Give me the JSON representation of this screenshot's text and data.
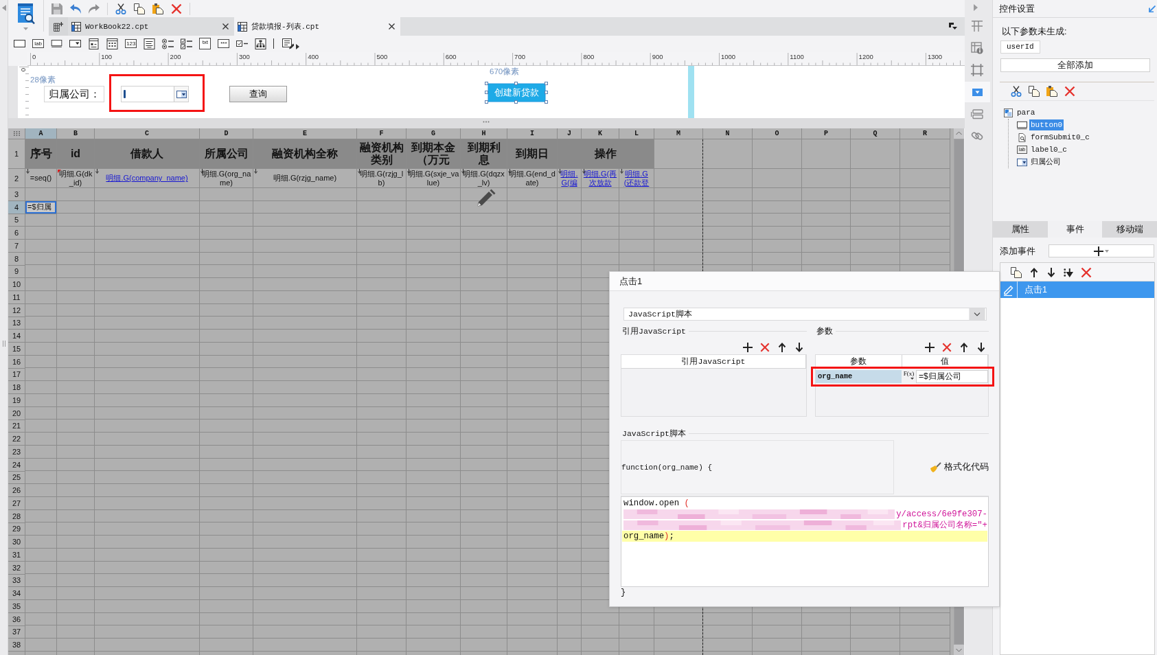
{
  "tabs": [
    {
      "label": "WorkBook22.cpt",
      "selected": false
    },
    {
      "label": "贷款填报-列表.cpt",
      "selected": true
    }
  ],
  "widget_palette": [
    {
      "kind": "text-field"
    },
    {
      "kind": "label",
      "text": "lab"
    },
    {
      "kind": "button"
    },
    {
      "kind": "combo"
    },
    {
      "kind": "form"
    },
    {
      "kind": "date"
    },
    {
      "kind": "number",
      "text": "123"
    },
    {
      "kind": "text-area"
    },
    {
      "kind": "radio-group"
    },
    {
      "kind": "checkbox-group"
    },
    {
      "kind": "file",
      "text": "txt"
    },
    {
      "kind": "password",
      "text": "***"
    },
    {
      "kind": "checkbox"
    },
    {
      "kind": "tree"
    },
    {
      "kind": "more"
    }
  ],
  "ruler": {
    "ticks": [
      "0",
      "100",
      "200",
      "300",
      "400",
      "500",
      "600",
      "700",
      "800",
      "900",
      "1000",
      "1100",
      "1200",
      "1300"
    ],
    "vertical_ticks": [
      "0"
    ]
  },
  "parameter_pane": {
    "height_hint": "28像素",
    "label": "归属公司：",
    "combo": {
      "annotated": true
    },
    "query_button": "查询",
    "position_hint": "670像素",
    "create_button": {
      "label": "创建新贷款",
      "selected": true
    }
  },
  "sheet": {
    "columns": [
      {
        "label": "A",
        "selected": true
      },
      {
        "label": "B",
        "selected": false
      },
      {
        "label": "C",
        "selected": false
      },
      {
        "label": "D",
        "selected": false
      },
      {
        "label": "E",
        "selected": false
      },
      {
        "label": "F",
        "selected": false
      },
      {
        "label": "G",
        "selected": false
      },
      {
        "label": "H",
        "selected": false
      },
      {
        "label": "I",
        "selected": false
      },
      {
        "label": "J",
        "selected": false
      },
      {
        "label": "K",
        "selected": false
      },
      {
        "label": "L",
        "selected": false
      },
      {
        "label": "M",
        "selected": false
      },
      {
        "label": "N",
        "selected": false
      },
      {
        "label": "O",
        "selected": false
      },
      {
        "label": "P",
        "selected": false
      },
      {
        "label": "Q",
        "selected": false
      },
      {
        "label": "R",
        "selected": false
      }
    ],
    "rows": [
      {
        "number": "1",
        "selected": false,
        "cells": [
          {
            "kind": "heading",
            "text": "序号",
            "selected": false
          },
          {
            "kind": "heading",
            "text": "id",
            "selected": false
          },
          {
            "kind": "heading",
            "text": "借款人",
            "selected": false
          },
          {
            "kind": "heading",
            "text": "所属公司",
            "selected": false
          },
          {
            "kind": "heading",
            "text": "融资机构全称",
            "selected": false
          },
          {
            "kind": "heading",
            "text": "融资机构类别",
            "selected": false
          },
          {
            "kind": "heading",
            "text": "到期本金（万元",
            "selected": false
          },
          {
            "kind": "heading",
            "text": "到期利息",
            "selected": false
          },
          {
            "kind": "heading",
            "text": "到期日",
            "selected": false
          },
          {
            "kind": "merged-heading",
            "text": "操作",
            "selected": false
          },
          {
            "kind": "covered"
          },
          {
            "kind": "covered"
          }
        ]
      },
      {
        "number": "2",
        "selected": false,
        "cells": [
          {
            "kind": "text",
            "text": "=seq()",
            "expand": true,
            "flagged": false,
            "selected": false
          },
          {
            "kind": "text",
            "text": "明细.G(dk_id)",
            "expand": false,
            "flagged": true,
            "selected": false
          },
          {
            "kind": "link",
            "text": "明细.G(company_name)",
            "expand": true,
            "flagged": false,
            "selected": false
          },
          {
            "kind": "text",
            "text": "明细.G(org_name)",
            "expand": true,
            "flagged": false,
            "selected": false
          },
          {
            "kind": "text",
            "text": "明细.G(rzjg_name)",
            "expand": true,
            "flagged": false,
            "selected": false
          },
          {
            "kind": "text",
            "text": "明细.G(rzjg_lb)",
            "expand": true,
            "flagged": false,
            "selected": false
          },
          {
            "kind": "text",
            "text": "明细.G(sxje_value)",
            "expand": true,
            "flagged": false,
            "selected": false
          },
          {
            "kind": "text",
            "text": "明细.G(dqzx_lv)",
            "expand": true,
            "flagged": false,
            "selected": false
          },
          {
            "kind": "text",
            "text": "明细.G(end_date)",
            "expand": true,
            "flagged": false,
            "selected": false
          },
          {
            "kind": "link",
            "text": "明细.G(编",
            "expand": true,
            "flagged": false,
            "selected": false
          },
          {
            "kind": "link",
            "text": "明细.G(再次放款",
            "expand": true,
            "flagged": false,
            "selected": false
          },
          {
            "kind": "link",
            "text": "明细.G(还款登",
            "expand": true,
            "flagged": false,
            "selected": false
          }
        ]
      },
      {
        "number": "3",
        "selected": false
      },
      {
        "number": "4",
        "selected": true,
        "cells": [
          {
            "kind": "text",
            "text": "=$归属",
            "selected": true
          }
        ]
      },
      {
        "number": "5",
        "selected": false
      },
      {
        "number": "6",
        "selected": false
      },
      {
        "number": "7",
        "selected": false
      },
      {
        "number": "8",
        "selected": false
      },
      {
        "number": "9",
        "selected": false
      },
      {
        "number": "10",
        "selected": false
      },
      {
        "number": "11",
        "selected": false
      },
      {
        "number": "12",
        "selected": false
      },
      {
        "number": "13",
        "selected": false
      },
      {
        "number": "14",
        "selected": false
      },
      {
        "number": "15",
        "selected": false
      },
      {
        "number": "16",
        "selected": false
      },
      {
        "number": "17",
        "selected": false
      },
      {
        "number": "18",
        "selected": false
      },
      {
        "number": "19",
        "selected": false
      },
      {
        "number": "20",
        "selected": false
      },
      {
        "number": "21",
        "selected": false
      },
      {
        "number": "22",
        "selected": false
      },
      {
        "number": "23",
        "selected": false
      },
      {
        "number": "24",
        "selected": false
      },
      {
        "number": "25",
        "selected": false
      },
      {
        "number": "26",
        "selected": false
      },
      {
        "number": "27",
        "selected": false
      },
      {
        "number": "28",
        "selected": false
      },
      {
        "number": "29",
        "selected": false
      },
      {
        "number": "30",
        "selected": false
      },
      {
        "number": "31",
        "selected": false
      },
      {
        "number": "32",
        "selected": false
      },
      {
        "number": "33",
        "selected": false
      },
      {
        "number": "34",
        "selected": false
      },
      {
        "number": "35",
        "selected": false
      },
      {
        "number": "36",
        "selected": false
      },
      {
        "number": "37",
        "selected": false
      },
      {
        "number": "38",
        "selected": false
      }
    ]
  },
  "side_tools": [
    {
      "kind": "table",
      "selected": false
    },
    {
      "kind": "table-info",
      "selected": false
    },
    {
      "kind": "frame",
      "selected": false
    },
    {
      "kind": "widget",
      "selected": true
    },
    {
      "kind": "list",
      "selected": false
    },
    {
      "kind": "link",
      "selected": false
    }
  ],
  "control_settings": {
    "title": "控件设置",
    "missing_label": "以下参数未生成:",
    "missing_params": [
      "userId"
    ],
    "add_all_button": "全部添加",
    "widgets": [
      {
        "label": "para",
        "kind": "container",
        "selected": false,
        "children": [
          {
            "label": "button0",
            "kind": "button",
            "selected": true
          },
          {
            "label": "formSubmit0_c",
            "kind": "submit",
            "selected": false
          },
          {
            "label": "label0_c",
            "kind": "label",
            "icon_text": "lab",
            "selected": false
          },
          {
            "label": "归属公司",
            "kind": "combo",
            "selected": false
          }
        ]
      }
    ]
  },
  "panel_tabs": [
    {
      "label": "属性",
      "selected": false
    },
    {
      "label": "事件",
      "selected": true
    },
    {
      "label": "移动端",
      "selected": false
    }
  ],
  "events": {
    "add_label": "添加事件",
    "items": [
      {
        "label": "点击1",
        "selected": true
      }
    ]
  },
  "event_dialog": {
    "title": "点击1",
    "type": "JavaScript脚本",
    "imported": {
      "legend": "引用JavaScript",
      "column": "引用JavaScript"
    },
    "params": {
      "legend": "参数",
      "columns": [
        "参数",
        "值"
      ],
      "rows": [
        {
          "name": "org_name",
          "formula": "F(x)",
          "value": "=$归属公司",
          "selected": true,
          "annotated": true
        }
      ]
    },
    "script": {
      "legend": "JavaScript脚本",
      "signature": "function(org_name) {",
      "format_button": "格式化代码",
      "lines": [
        {
          "current": false,
          "redacted": false,
          "segments": [
            {
              "kind": "code",
              "text": "window.open "
            },
            {
              "kind": "paren",
              "text": "("
            }
          ]
        },
        {
          "current": false,
          "redacted": true,
          "segments": [
            {
              "kind": "string",
              "text": "y/access/6e9fe307-"
            }
          ]
        },
        {
          "current": false,
          "redacted": true,
          "segments": [
            {
              "kind": "string",
              "text": "rpt&归属公司名称=\"+"
            }
          ]
        },
        {
          "current": true,
          "redacted": false,
          "segments": [
            {
              "kind": "code",
              "text": "org_name"
            },
            {
              "kind": "paren",
              "text": ")"
            },
            {
              "kind": "code",
              "text": ";"
            }
          ]
        }
      ],
      "closing": "}"
    }
  }
}
